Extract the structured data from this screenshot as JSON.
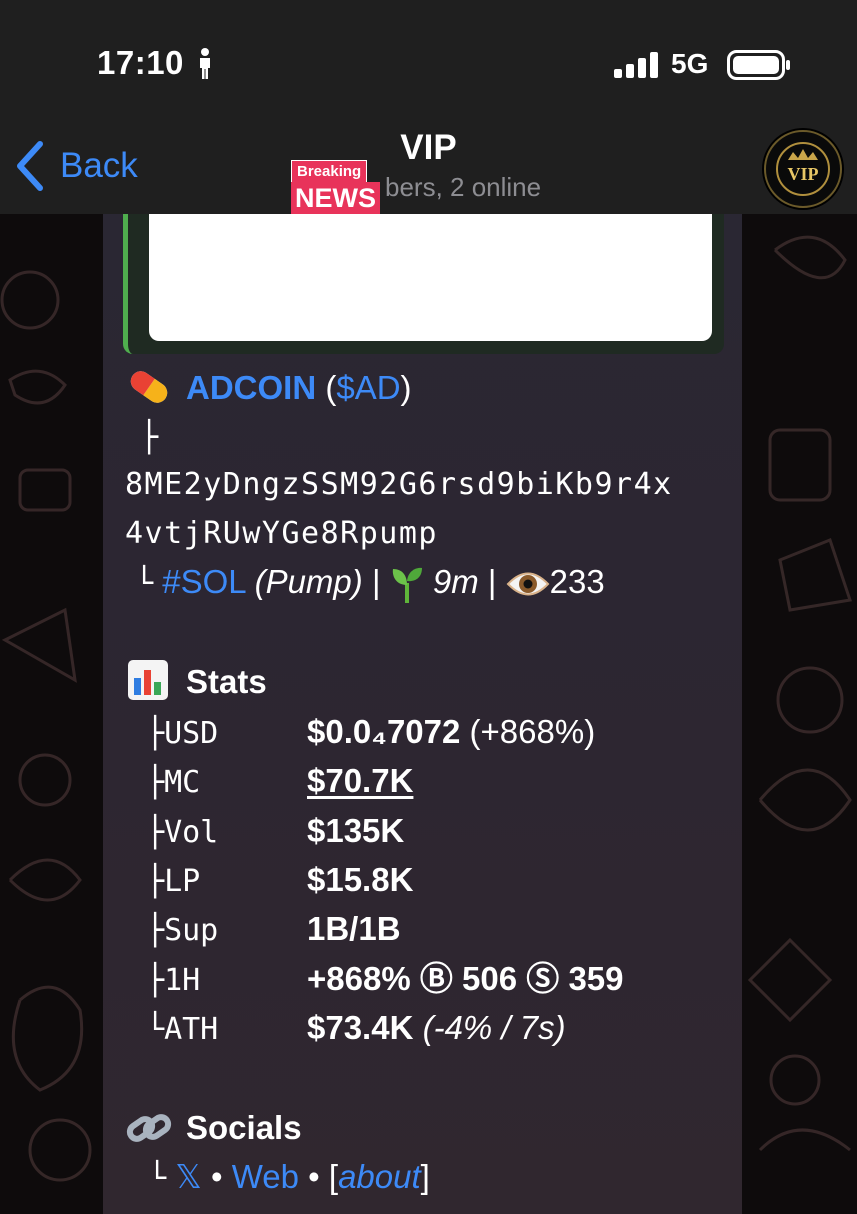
{
  "status_bar": {
    "time": "17:10",
    "network": "5G"
  },
  "header": {
    "back_label": "Back",
    "title": "VIP",
    "subtitle": "bers, 2 online",
    "news_badge": {
      "top": "Breaking",
      "bottom": "NEWS"
    },
    "avatar_text": "VIP"
  },
  "message": {
    "token_name": "ADCOIN",
    "ticker_open": "(",
    "ticker": "$AD",
    "ticker_close": ")",
    "tree_branch": "├",
    "address_line1": "8ME2yDngzSSM92G6rsd9biKb9r4x",
    "address_line2": "4vtjRUwYGe8Rpump",
    "tree_end": "└",
    "chain_tag": "#SOL",
    "platform": "(Pump)",
    "sep": "|",
    "age": "9m",
    "views": "233",
    "stats_title": "Stats",
    "stats": [
      {
        "prefix": "├",
        "label": "USD",
        "value": "$0.0₄7072",
        "extra": "(+868%)",
        "extra_style": "normal"
      },
      {
        "prefix": "├",
        "label": "MC",
        "value": "$70.7K",
        "extra": "",
        "extra_style": "link"
      },
      {
        "prefix": "├",
        "label": "Vol",
        "value": "$135K",
        "extra": "",
        "extra_style": "normal"
      },
      {
        "prefix": "├",
        "label": "LP",
        "value": "$15.8K",
        "extra": "",
        "extra_style": "normal"
      },
      {
        "prefix": "├",
        "label": "Sup",
        "value": "1B/1B",
        "extra": "",
        "extra_style": "normal"
      },
      {
        "prefix": "├",
        "label": "1H",
        "value": "+868%",
        "extra": "",
        "extra_style": "normal"
      },
      {
        "prefix": "└",
        "label": "ATH",
        "value": "$73.4K",
        "extra": "(-4% / 7s)",
        "extra_style": "italic"
      }
    ],
    "buys_icon": "Ⓑ",
    "buys": "506",
    "sells_icon": "Ⓢ",
    "sells": "359",
    "socials_title": "Socials",
    "socials_prefix": "└",
    "social_x": "𝕏",
    "dot": "•",
    "social_web": "Web",
    "bracket_open": "[",
    "social_about": "about",
    "bracket_close": "]"
  },
  "colors": {
    "link": "#3d8af7",
    "accent_green": "#4fae4e",
    "header_bg": "#1f1f1f"
  },
  "icons": [
    "person-icon",
    "signal-icon",
    "battery-icon",
    "chevron-left-icon",
    "pill-icon",
    "seedling-icon",
    "eye-icon",
    "bar-chart-icon",
    "link-icon"
  ]
}
